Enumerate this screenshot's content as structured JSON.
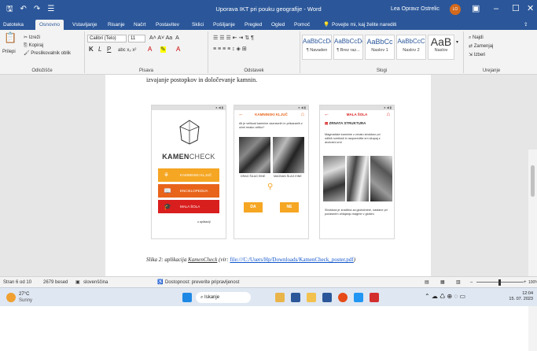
{
  "titlebar": {
    "title": "Uporava IKT pri pouku geografije - Word",
    "user": "Lea Opravz Ostrelic",
    "avatar": "LO"
  },
  "tabs": [
    "Datoteka",
    "Osnovno",
    "Vstavljanje",
    "Risanje",
    "Načrt",
    "Postavitev",
    "Sklici",
    "Pošiljanje",
    "Pregled",
    "Ogled",
    "Pomoč"
  ],
  "tellme": "Povejte mi, kaj želite narediti",
  "clipboard": {
    "paste": "Prilepi",
    "cut": "Izreži",
    "copy": "Kopiraj",
    "format": "Preslikovalnik oblik",
    "label": "Odložišče"
  },
  "font": {
    "name": "Calibri (Telo)",
    "size": "11",
    "label": "Pisava"
  },
  "paragraph": {
    "label": "Odstavek"
  },
  "styles": {
    "items": [
      {
        "sample": "AaBbCcDc",
        "name": "¶ Navaden"
      },
      {
        "sample": "AaBbCcDc",
        "name": "¶ Brez raz..."
      },
      {
        "sample": "AaBbCc",
        "name": "Naslov 1"
      },
      {
        "sample": "AaBbCcC",
        "name": "Naslov 2"
      },
      {
        "sample": "AaB",
        "name": "Naslov"
      }
    ],
    "label": "Slogi"
  },
  "editing": {
    "find": "Najdi",
    "replace": "Zamenjaj",
    "select": "Izberi",
    "label": "Urejanje"
  },
  "document": {
    "intro": "izvajanje postopkov in določevanje kamnin.",
    "caption_prefix": "Slika 2: aplikacija ",
    "caption_app": "KamenCheck",
    "caption_mid": " (vir: ",
    "caption_link": "file:///C:/Users/Hp/Downloads/KamenCheck_poster.pdf",
    "caption_suffix": ")"
  },
  "app": {
    "status": "● ◀ ▮",
    "logo_bold": "KAMEN",
    "logo_rest": "CHECK",
    "btn1": "KAMNINSKI KLJUČ",
    "btn2": "ENCIKLOPEDIJA",
    "btn3": "MALA ŠOLA",
    "author": "o aplikaciji",
    "screen2_title": "KAMNINSKI KLJUČ",
    "screen2_q": "Ali je velikost kamnine zaznavnih in prikazanih z očmi enako veliko?",
    "screen2_cap1": "DRAG ŠILAG EINE",
    "screen2_cap2": "MAGNAN ŠLAG EINE",
    "yes": "DA",
    "no": "NE",
    "screen3_title": "MALA ŠOLA",
    "screen3_section": "ZRNATA STRUKTURA",
    "screen3_text": "Magmatske kamnine z zrnato strukturo pri odlkih svetlosti in razporeditvi zrn skupaj z drobnimi zrni",
    "screen3_text2": "Struktura je značilna za globočnine, nastane pri počasnem ohlajanju magme v globini."
  },
  "statusbar": {
    "page": "Stran 6 od 10",
    "words": "2679 besed",
    "lang": "slovenščina",
    "access": "Dostopnost: preverite pripravljenost",
    "zoom": "100%"
  },
  "taskbar": {
    "temp": "27°C",
    "weather": "Sunny",
    "search": "Iskanje",
    "time": "12:04",
    "date": "15. 07. 2023"
  }
}
